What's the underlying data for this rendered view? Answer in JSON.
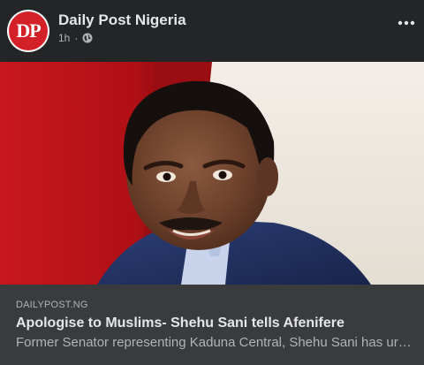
{
  "post": {
    "page_name": "Daily Post Nigeria",
    "avatar_initials": "DP",
    "timestamp": "1h",
    "separator": "·",
    "privacy_icon": "globe-icon",
    "more_icon": "more-horizontal-icon"
  },
  "link_preview": {
    "domain": "DAILYPOST.NG",
    "headline": "Apologise to Muslims- Shehu Sani tells Afenifere",
    "description": "Former Senator representing Kaduna Central, Shehu Sani has urged the Afenifere"
  },
  "colors": {
    "background": "#242526",
    "link_preview_bg": "#3a3b3c",
    "brand_red": "#d42027",
    "primary_text": "#e4e6eb",
    "secondary_text": "#b0b3b8"
  }
}
